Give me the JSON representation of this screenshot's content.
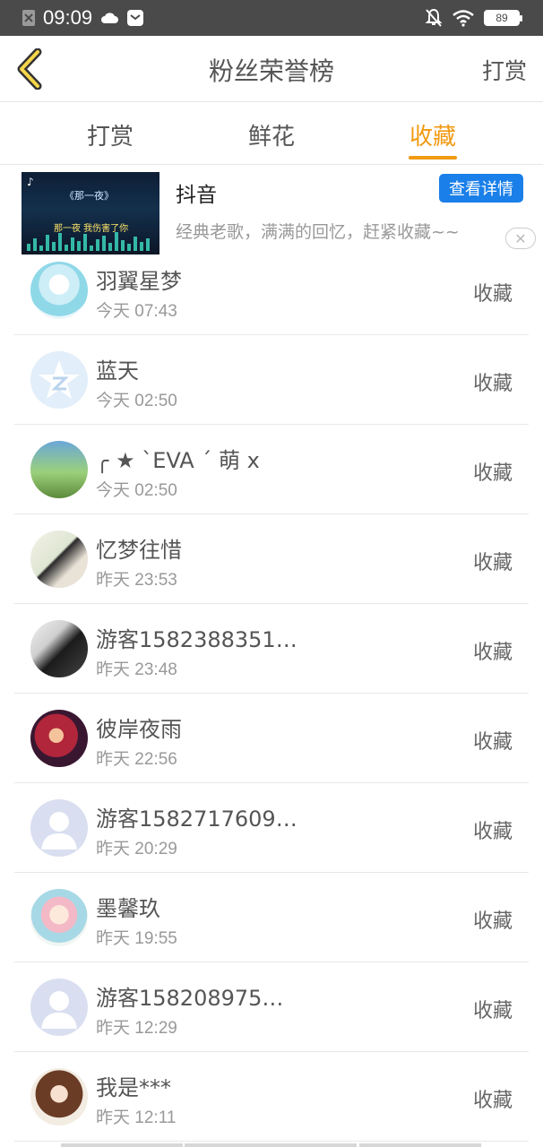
{
  "status_bar": {
    "time": "09:09",
    "battery": "89"
  },
  "header": {
    "title": "粉丝荣誉榜",
    "action": "打赏"
  },
  "tabs": [
    {
      "label": "打赏",
      "active": false
    },
    {
      "label": "鲜花",
      "active": false
    },
    {
      "label": "收藏",
      "active": true
    }
  ],
  "ad": {
    "thumb_title": "《那一夜》",
    "thumb_caption": "那一夜 我伤害了你",
    "title": "抖音",
    "description": "经典老歌，满满的回忆，赶紧收藏~~",
    "button": "查看详情",
    "close": "✕"
  },
  "list": [
    {
      "name": "羽翼星梦",
      "time": "今天 07:43",
      "action": "收藏"
    },
    {
      "name": "蓝天",
      "time": "今天 02:50",
      "action": "收藏"
    },
    {
      "name": "╭ ★ ˋEVA ˊ 萌 x",
      "time": "今天 02:50",
      "action": "收藏"
    },
    {
      "name": "忆梦往惜",
      "time": "昨天 23:53",
      "action": "收藏"
    },
    {
      "name": "游客1582388351…",
      "time": "昨天 23:48",
      "action": "收藏"
    },
    {
      "name": "彼岸夜雨",
      "time": "昨天 22:56",
      "action": "收藏"
    },
    {
      "name": "游客1582717609…",
      "time": "昨天 20:29",
      "action": "收藏"
    },
    {
      "name": "墨馨玖",
      "time": "昨天 19:55",
      "action": "收藏"
    },
    {
      "name": "游客158208975…",
      "time": "昨天 12:29",
      "action": "收藏"
    },
    {
      "name": "我是***",
      "time": "昨天 12:11",
      "action": "收藏"
    }
  ],
  "colors": {
    "accent": "#f19a13",
    "ad_button": "#1a7fe8",
    "status_bar": "#4a4a4a"
  }
}
